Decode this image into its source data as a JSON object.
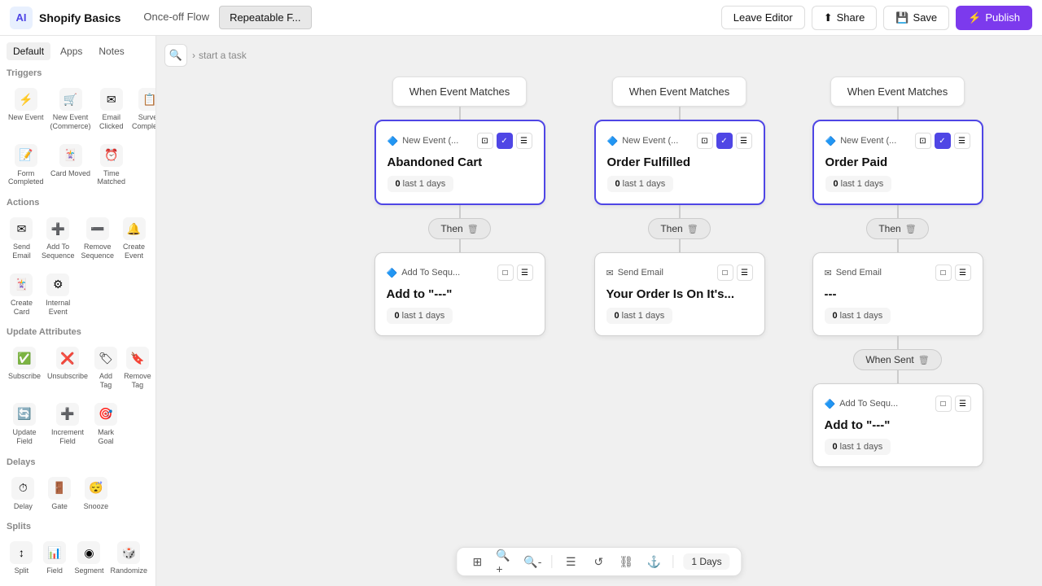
{
  "topbar": {
    "logo": "AI",
    "title": "Shopify Basics",
    "tab_once": "Once-off Flow",
    "tab_repeatable": "Repeatable F...",
    "btn_leave": "Leave Editor",
    "btn_share": "Share",
    "btn_save": "Save",
    "btn_publish": "Publish"
  },
  "sidebar": {
    "tabs": [
      "Default",
      "Apps",
      "Notes"
    ],
    "active_tab": "Default",
    "sections": {
      "triggers": {
        "label": "Triggers",
        "items": [
          {
            "label": "New Event",
            "icon": "⚡"
          },
          {
            "label": "New Event (Commerce)",
            "icon": "🛒"
          },
          {
            "label": "Email Clicked",
            "icon": "✉️"
          },
          {
            "label": "Survey Completed",
            "icon": "📋"
          },
          {
            "label": "Form Completed",
            "icon": "📝"
          },
          {
            "label": "Card Moved",
            "icon": "🃏"
          },
          {
            "label": "Time Matched",
            "icon": "⏰"
          }
        ]
      },
      "actions": {
        "label": "Actions",
        "items": [
          {
            "label": "Send Email",
            "icon": "✉"
          },
          {
            "label": "Add To Sequence",
            "icon": "➕"
          },
          {
            "label": "Remove Sequence",
            "icon": "➖"
          },
          {
            "label": "Create Event",
            "icon": "🔔"
          },
          {
            "label": "Create Card",
            "icon": "🃏"
          },
          {
            "label": "Internal Event",
            "icon": "⚙"
          }
        ]
      },
      "update_attributes": {
        "label": "Update Attributes",
        "items": [
          {
            "label": "Subscribe",
            "icon": "✅"
          },
          {
            "label": "Unsubscribe",
            "icon": "❌"
          },
          {
            "label": "Add Tag",
            "icon": "🏷"
          },
          {
            "label": "Remove Tag",
            "icon": "🔖"
          },
          {
            "label": "Update Field",
            "icon": "🔄"
          },
          {
            "label": "Increment Field",
            "icon": "➕"
          },
          {
            "label": "Mark Goal",
            "icon": "🎯"
          }
        ]
      },
      "delays": {
        "label": "Delays",
        "items": [
          {
            "label": "Delay",
            "icon": "⏱"
          },
          {
            "label": "Gate",
            "icon": "🚪"
          },
          {
            "label": "Snooze",
            "icon": "😴"
          }
        ]
      },
      "splits": {
        "label": "Splits",
        "items": [
          {
            "label": "Split",
            "icon": "↕"
          },
          {
            "label": "Field",
            "icon": "📊"
          },
          {
            "label": "Segment",
            "icon": "◉"
          },
          {
            "label": "Randomize",
            "icon": "🎲"
          }
        ]
      }
    }
  },
  "canvas": {
    "breadcrumb": "start a task",
    "columns": [
      {
        "id": "col1",
        "when_header": "When Event Matches",
        "trigger_node": {
          "type": "New Event (...",
          "title": "Abandoned Cart",
          "stat_count": "0",
          "stat_label": "last 1 days",
          "selected": true
        },
        "then_label": "Then",
        "action_node": {
          "type": "Add To Sequ...",
          "title": "Add to \"---\"",
          "stat_count": "0",
          "stat_label": "last 1 days",
          "selected": false
        }
      },
      {
        "id": "col2",
        "when_header": "When Event Matches",
        "trigger_node": {
          "type": "New Event (...",
          "title": "Order Fulfilled",
          "stat_count": "0",
          "stat_label": "last 1 days",
          "selected": true
        },
        "then_label": "Then",
        "action_node": {
          "type": "Send Email",
          "title": "Your Order Is On It's...",
          "stat_count": "0",
          "stat_label": "last 1 days",
          "selected": false
        }
      },
      {
        "id": "col3",
        "when_header": "When Event Matches",
        "trigger_node": {
          "type": "New Event (...",
          "title": "Order Paid",
          "stat_count": "0",
          "stat_label": "last 1 days",
          "selected": true
        },
        "then_label": "Then",
        "action_node": {
          "type": "Send Email",
          "title": "---",
          "stat_count": "0",
          "stat_label": "last 1 days",
          "selected": false
        },
        "when_sent_label": "When Sent",
        "extra_node": {
          "type": "Add To Sequ...",
          "title": "Add to \"---\"",
          "stat_count": "0",
          "stat_label": "last 1 days",
          "selected": false
        }
      }
    ],
    "bottom_toolbar": {
      "days": "1 Days"
    }
  }
}
